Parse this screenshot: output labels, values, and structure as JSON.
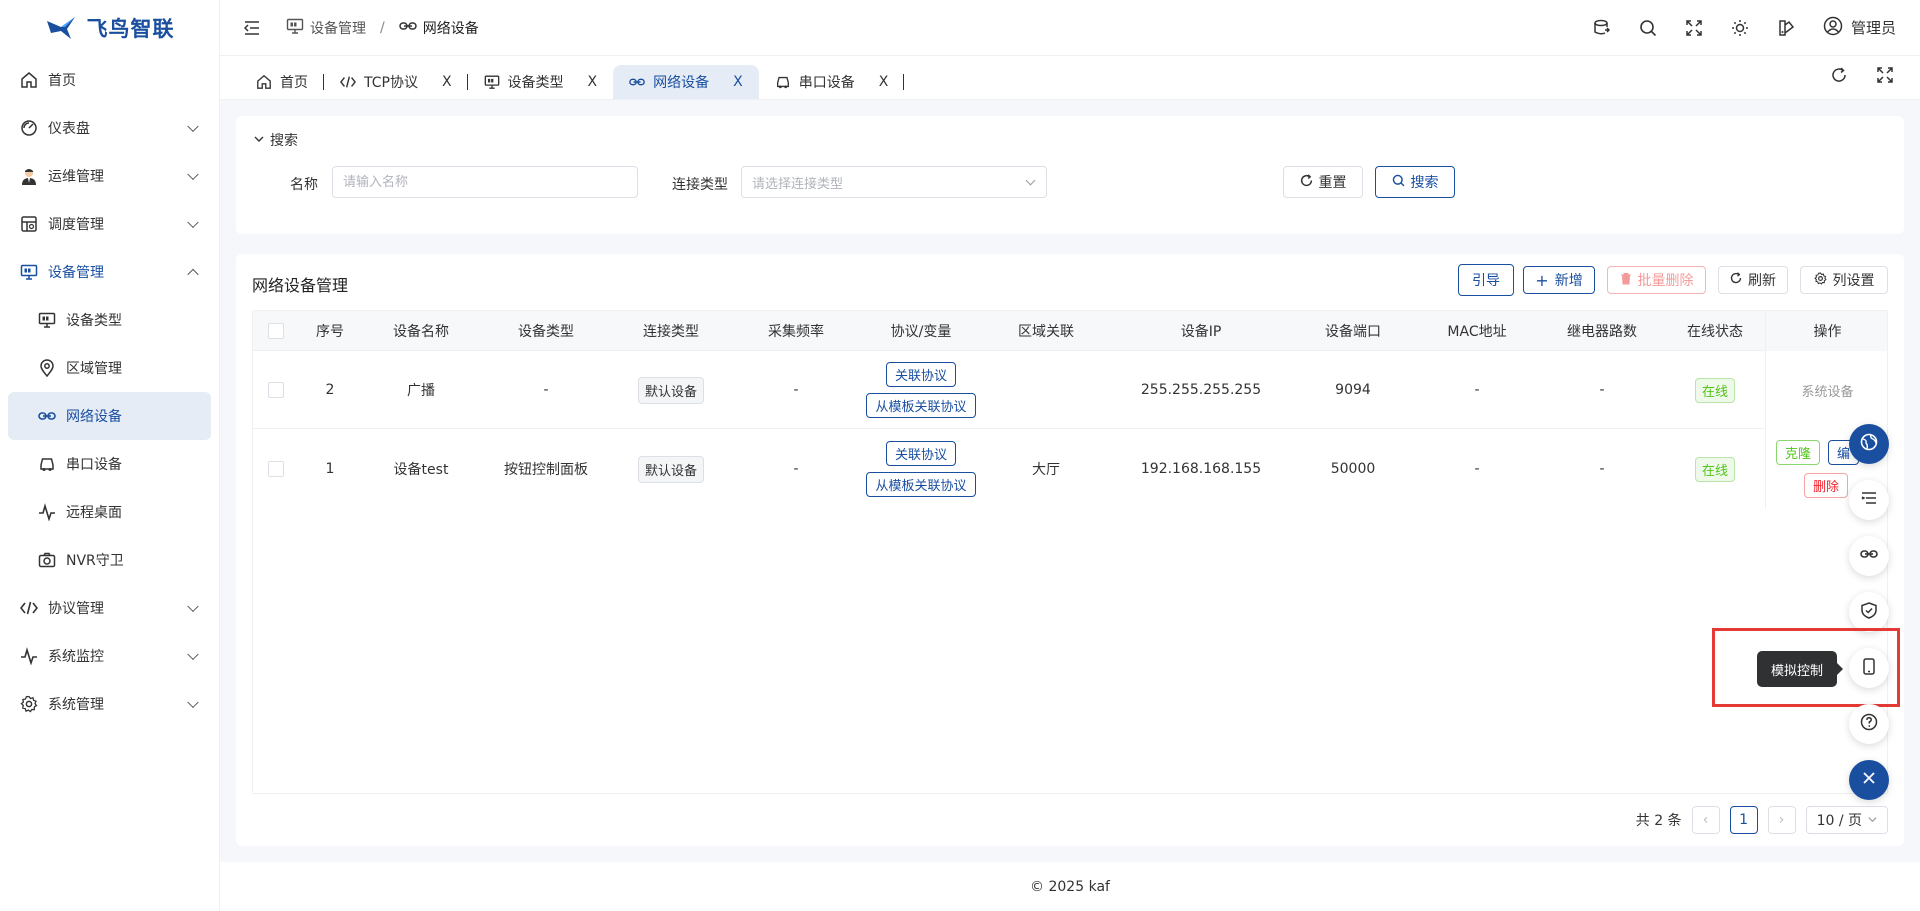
{
  "app": {
    "logo_text": "飞鸟智联"
  },
  "sidebar": {
    "items": [
      {
        "label": "首页",
        "icon": "home-icon"
      },
      {
        "label": "仪表盘",
        "icon": "dashboard-icon"
      },
      {
        "label": "运维管理",
        "icon": "avatar-icon"
      },
      {
        "label": "调度管理",
        "icon": "schedule-icon"
      },
      {
        "label": "设备管理",
        "icon": "monitor-icon"
      },
      {
        "label": "协议管理",
        "icon": "code-icon"
      },
      {
        "label": "系统监控",
        "icon": "pulse-icon"
      },
      {
        "label": "系统管理",
        "icon": "gear-icon"
      }
    ],
    "device_sub": [
      {
        "label": "设备类型",
        "icon": "monitor-icon"
      },
      {
        "label": "区域管理",
        "icon": "location-icon"
      },
      {
        "label": "网络设备",
        "icon": "link-icon"
      },
      {
        "label": "串口设备",
        "icon": "car-icon"
      },
      {
        "label": "远程桌面",
        "icon": "pulse-icon"
      },
      {
        "label": "NVR守卫",
        "icon": "camera-icon"
      }
    ]
  },
  "header": {
    "breadcrumb": [
      "设备管理",
      "网络设备"
    ],
    "separator": "/",
    "user": "管理员"
  },
  "tabs": [
    {
      "label": "首页",
      "close": ""
    },
    {
      "label": "TCP协议",
      "close": "X"
    },
    {
      "label": "设备类型",
      "close": "X"
    },
    {
      "label": "网络设备",
      "close": "X"
    },
    {
      "label": "串口设备",
      "close": "X"
    }
  ],
  "search": {
    "title": "搜索",
    "name_label": "名称",
    "name_placeholder": "请输入名称",
    "conn_label": "连接类型",
    "conn_placeholder": "请选择连接类型",
    "reset": "重置",
    "search": "搜索"
  },
  "table": {
    "title": "网络设备管理",
    "toolbar": {
      "guide": "引导",
      "add": "新增",
      "batch_delete": "批量删除",
      "refresh": "刷新",
      "columns": "列设置"
    },
    "columns": [
      "序号",
      "设备名称",
      "设备类型",
      "连接类型",
      "采集频率",
      "协议/变量",
      "区域关联",
      "设备IP",
      "设备端口",
      "MAC地址",
      "继电器路数",
      "在线状态",
      "操作"
    ],
    "rows": [
      {
        "seq": "2",
        "name": "广播",
        "type": "-",
        "conn": "默认设备",
        "freq": "-",
        "proto1": "关联协议",
        "proto2": "从模板关联协议",
        "area": "",
        "ip": "255.255.255.255",
        "port": "9094",
        "mac": "-",
        "relay": "-",
        "status": "在线",
        "op_text": "系统设备"
      },
      {
        "seq": "1",
        "name": "设备test",
        "type": "按钮控制面板",
        "conn": "默认设备",
        "freq": "-",
        "proto1": "关联协议",
        "proto2": "从模板关联协议",
        "area": "大厅",
        "ip": "192.168.168.155",
        "port": "50000",
        "mac": "-",
        "relay": "-",
        "status": "在线",
        "op_clone": "克隆",
        "op_edit": "编",
        "op_delete": "删除"
      }
    ],
    "pager": {
      "total": "共 2 条",
      "page": "1",
      "size": "10 / 页"
    }
  },
  "footer": {
    "text": "© 2025 kaf"
  },
  "float": {
    "tooltip": "模拟控制"
  },
  "colors": {
    "primary": "#1a4fa0",
    "danger": "#e53935",
    "success": "#52c41a"
  }
}
